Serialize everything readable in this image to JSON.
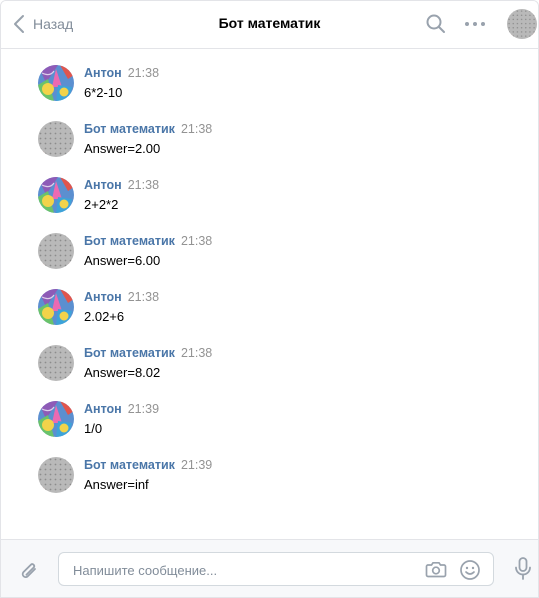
{
  "header": {
    "back_label": "Назад",
    "title": "Бот математик"
  },
  "composer": {
    "placeholder": "Напишите сообщение..."
  },
  "colors": {
    "accent": "#4a76a8",
    "icon_gray": "#99a2ad",
    "muted_text": "#818c99"
  },
  "messages": [
    {
      "author": "Антон",
      "time": "21:38",
      "text": "6*2-10",
      "avatar": "user"
    },
    {
      "author": "Бот математик",
      "time": "21:38",
      "text": "Answer=2.00",
      "avatar": "bot"
    },
    {
      "author": "Антон",
      "time": "21:38",
      "text": "2+2*2",
      "avatar": "user"
    },
    {
      "author": "Бот математик",
      "time": "21:38",
      "text": "Answer=6.00",
      "avatar": "bot"
    },
    {
      "author": "Антон",
      "time": "21:38",
      "text": "2.02+6",
      "avatar": "user"
    },
    {
      "author": "Бот математик",
      "time": "21:38",
      "text": "Answer=8.02",
      "avatar": "bot"
    },
    {
      "author": "Антон",
      "time": "21:39",
      "text": "1/0",
      "avatar": "user"
    },
    {
      "author": "Бот математик",
      "time": "21:39",
      "text": "Answer=inf",
      "avatar": "bot"
    }
  ]
}
